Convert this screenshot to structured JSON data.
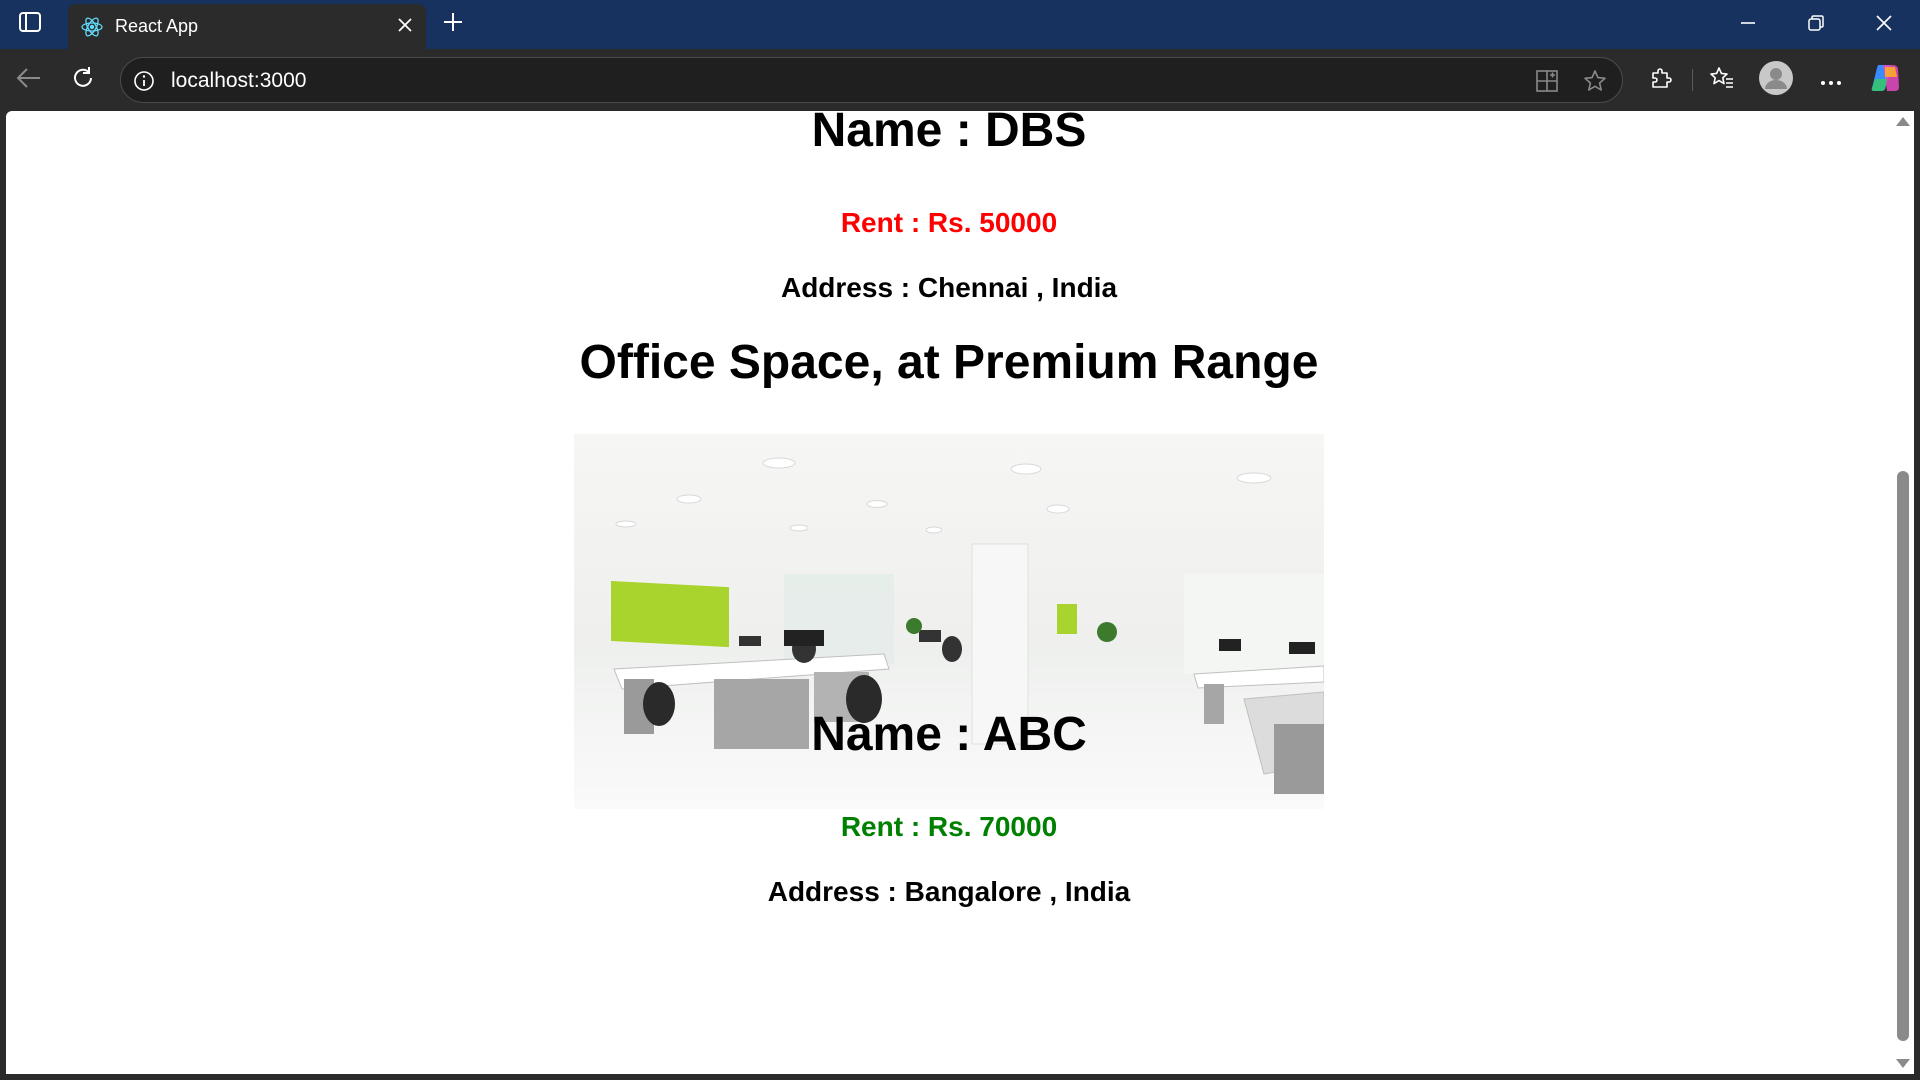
{
  "browser": {
    "tab_title": "React App",
    "url": "localhost:3000"
  },
  "page": {
    "listings": [
      {
        "name": "Name : DBS",
        "rent": "Rent : Rs. 50000",
        "address": "Address : Chennai , India",
        "rent_color": "#ff0000"
      },
      {
        "name": "Name : ABC",
        "rent": "Rent : Rs. 70000",
        "address": "Address : Bangalore , India",
        "rent_color": "#008000"
      }
    ],
    "section_title": "Office Space, at Premium Range"
  },
  "icons": {
    "tab_actions": "tab-actions-icon",
    "favicon": "react-logo-icon",
    "close": "close-icon",
    "new_tab": "plus-icon",
    "back": "back-arrow-icon",
    "refresh": "refresh-icon",
    "info": "info-icon",
    "apps": "app-available-icon",
    "favorite": "star-icon",
    "extensions": "puzzle-icon",
    "favorites": "favorites-icon",
    "profile": "profile-icon",
    "more": "more-icon",
    "copilot": "copilot-icon"
  },
  "colors": {
    "titlebar": "#17325e",
    "toolbar": "#2b2b2b",
    "rent_low": "#ff0000",
    "rent_high": "#008000"
  }
}
